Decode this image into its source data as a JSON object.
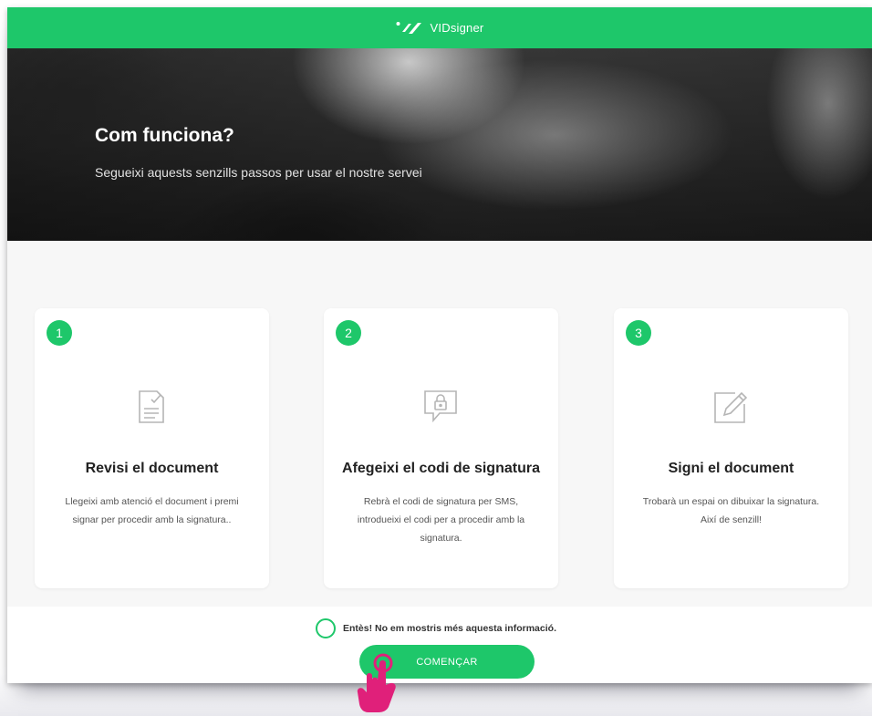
{
  "header": {
    "brand_name": "VIDsigner",
    "logo_icon": "vidsigner-logo",
    "bar_color": "#1ec76a"
  },
  "hero": {
    "title": "Com funciona?",
    "subtitle": "Segueixi aquests senzills passos per usar el nostre servei"
  },
  "steps": [
    {
      "number": "1",
      "icon": "document-check-icon",
      "title": "Revisi el document",
      "description": "Llegeixi amb atenció el document i premi signar per procedir amb la signatura.."
    },
    {
      "number": "2",
      "icon": "message-lock-icon",
      "title": "Afegeixi el codi de signatura",
      "description": "Rebrà el codi de signatura per SMS, introdueixi el codi per a procedir amb la signatura."
    },
    {
      "number": "3",
      "icon": "edit-signature-icon",
      "title": "Signi el document",
      "description": "Trobarà un espai on dibuixar la signatura. Així de senzill!"
    }
  ],
  "footer": {
    "checkbox_label": "Entès! No em mostris més aquesta informació.",
    "checkbox_checked": false,
    "start_button_label": "COMENÇAR"
  },
  "colors": {
    "accent": "#1ec76a",
    "cursor": "#e0207a"
  }
}
